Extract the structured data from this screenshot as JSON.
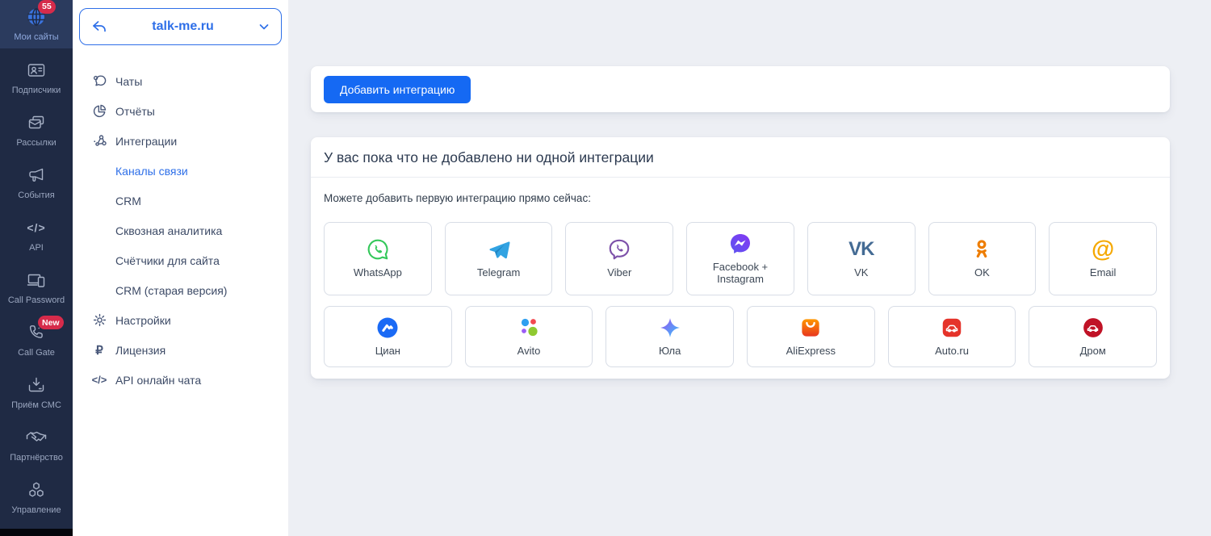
{
  "colors": {
    "accent_blue": "#1569f3",
    "link_blue": "#2e6fe8",
    "rail_bg": "#1f2a44",
    "rail_active_bg": "#2b3b5e",
    "badge_red": "#d62b4b",
    "page_bg": "#edeff4",
    "whatsapp_green": "#34c85a",
    "telegram_blue": "#32a3e2",
    "viber_purple": "#7d51a9",
    "messenger_purple": "#6e3ff2",
    "vk_blue": "#446b94",
    "ok_orange": "#ee7d00",
    "email_amber": "#f5a800",
    "cian_blue": "#1a6af5",
    "auto_ru_red": "#e5332a",
    "drom_red": "#c01226"
  },
  "rail": {
    "items": [
      {
        "label": "Мои сайты",
        "badge": "55",
        "icon": "globe-icon",
        "active": true
      },
      {
        "label": "Подписчики",
        "icon": "subscribers-card-icon"
      },
      {
        "label": "Рассылки",
        "icon": "mailing-envelopes-icon"
      },
      {
        "label": "События",
        "icon": "megaphone-icon"
      },
      {
        "label": "API",
        "icon": "code-icon",
        "glyph": "</>"
      },
      {
        "label": "Call Password",
        "icon": "devices-icon"
      },
      {
        "label": "Call Gate",
        "badge": "New",
        "icon": "phone-handset-icon"
      },
      {
        "label": "Приём СМС",
        "icon": "inbox-download-icon"
      },
      {
        "label": "Партнёрство",
        "icon": "handshake-icon"
      },
      {
        "label": "Управление",
        "icon": "cubes-icon"
      }
    ]
  },
  "subnav": {
    "site": "talk-me.ru",
    "items": [
      {
        "label": "Чаты",
        "icon": "chat-bubble-icon"
      },
      {
        "label": "Отчёты",
        "icon": "pie-chart-icon"
      },
      {
        "label": "Интеграции",
        "icon": "nodes-icon"
      },
      {
        "label": "Каналы связи",
        "sub": true,
        "active": true
      },
      {
        "label": "CRM",
        "sub": true
      },
      {
        "label": "Сквозная аналитика",
        "sub": true
      },
      {
        "label": "Счётчики для сайта",
        "sub": true
      },
      {
        "label": "CRM (старая версия)",
        "sub": true
      },
      {
        "label": "Настройки",
        "icon": "gear-icon"
      },
      {
        "label": "Лицензия",
        "icon": "ruble-icon",
        "glyph": "₽"
      },
      {
        "label": "API онлайн чата",
        "icon": "code-icon",
        "glyph": "</>"
      }
    ]
  },
  "main": {
    "add_button": "Добавить интеграцию",
    "empty_title": "У вас пока что не добавлено ни одной интеграции",
    "empty_subtitle": "Можете добавить первую интеграцию прямо сейчас:",
    "integrations_row1": [
      {
        "label": "WhatsApp",
        "icon": "whatsapp-icon"
      },
      {
        "label": "Telegram",
        "icon": "telegram-icon"
      },
      {
        "label": "Viber",
        "icon": "viber-icon"
      },
      {
        "label": "Facebook + Instagram",
        "icon": "messenger-icon"
      },
      {
        "label": "VK",
        "icon": "vk-icon",
        "glyph": "VK"
      },
      {
        "label": "OK",
        "icon": "ok-icon"
      },
      {
        "label": "Email",
        "icon": "email-at-icon",
        "glyph": "@"
      }
    ],
    "integrations_row2": [
      {
        "label": "Циан",
        "icon": "cian-icon"
      },
      {
        "label": "Avito",
        "icon": "avito-icon"
      },
      {
        "label": "Юла",
        "icon": "yula-icon"
      },
      {
        "label": "AliExpress",
        "icon": "aliexpress-icon"
      },
      {
        "label": "Auto.ru",
        "icon": "auto-ru-icon"
      },
      {
        "label": "Дром",
        "icon": "drom-icon"
      }
    ]
  }
}
